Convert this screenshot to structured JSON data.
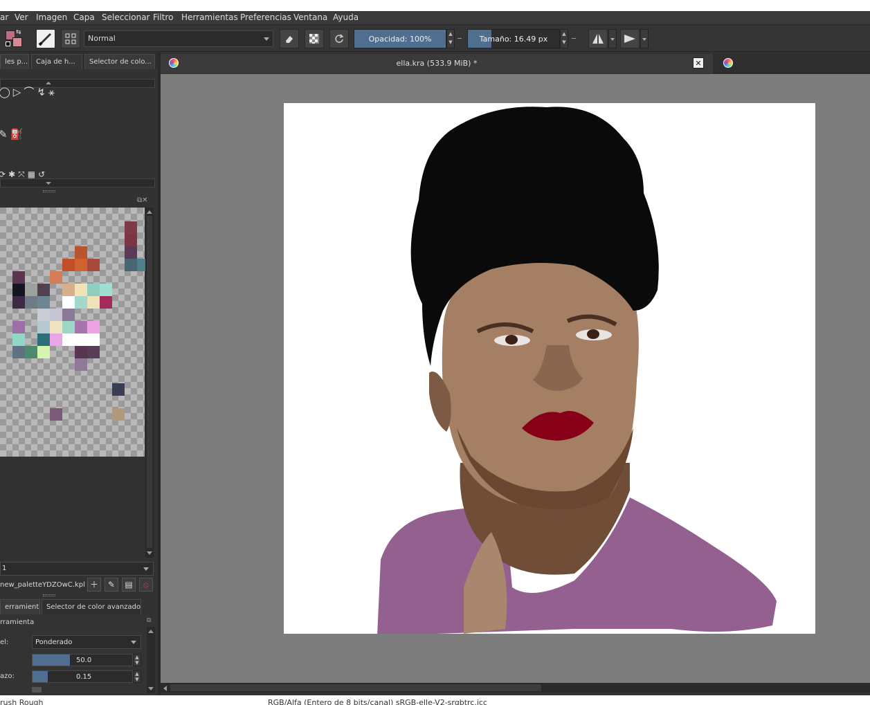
{
  "menu": [
    "ar",
    "Ver",
    "Imagen",
    "Capa",
    "Seleccionar",
    "Filtro",
    "Herramientas",
    "Preferencias",
    "Ventana",
    "Ayuda"
  ],
  "toolbar": {
    "blend_mode": "Normal",
    "opacity_label": "Opacidad: 100%",
    "opacity_value": 1.0,
    "size_label": "Tamaño: 16.49 px"
  },
  "left_tabs": [
    "les p...",
    "Caja de h...",
    "Selector de colo..."
  ],
  "palette": {
    "footer_value": "1",
    "file_name": "new_paletteYDZOwC.kpl"
  },
  "bottom_tabs": [
    "erramienta",
    "Selector de color avanzado"
  ],
  "tool_options": {
    "section_title": "rramienta",
    "mode_label": "el:",
    "mode_value": "Ponderado",
    "field1_value": "50.0",
    "field2_label": "azo:",
    "field2_value": "0.15"
  },
  "document": {
    "title": "ella.kra (533.9 MiB) *"
  },
  "status": {
    "brush": "rush Rough",
    "color_profile": "RGB/Alfa (Entero de 8 bits/canal)  sRGB-elle-V2-srgbtrc.icc"
  },
  "colors": {
    "accent": "#506f90",
    "canvas_bg": "#7d7d7d",
    "panel_bg": "#323232",
    "hair": "#0a0a0a",
    "skin": "#a47e62",
    "skin_shadow": "#6d4a33",
    "lips": "#870017",
    "garment": "#93608f"
  }
}
